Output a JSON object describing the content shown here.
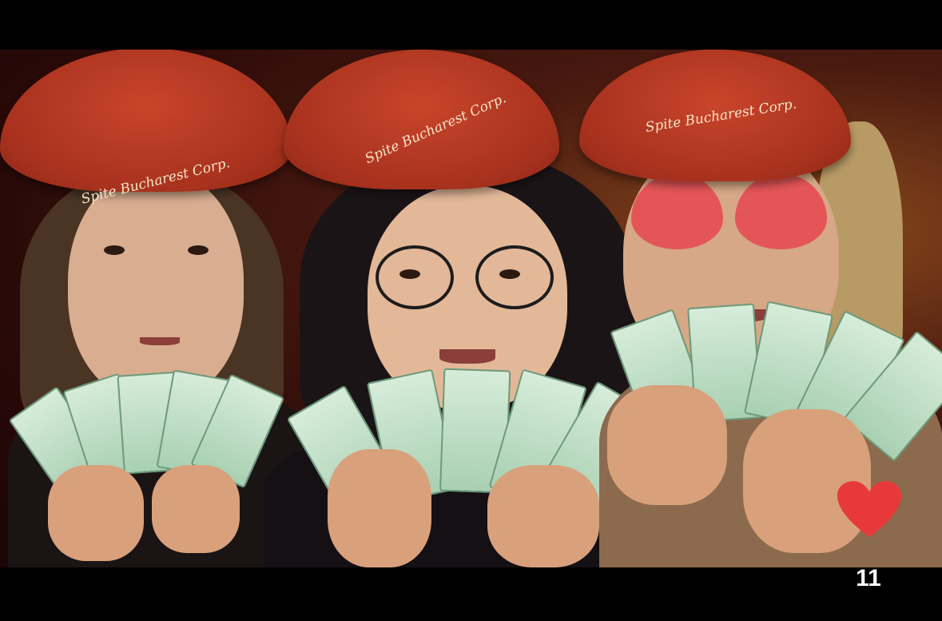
{
  "beret_text": {
    "left": "Spite Bucharest Corp.",
    "center": "Spite Bucharest Corp.",
    "right": "Spite Bucharest Corp."
  },
  "reaction": {
    "icon": "heart-icon",
    "color": "#e8393a",
    "count": "11"
  },
  "colors": {
    "beret": "#b0361f",
    "beret_text": "#f3e6c9",
    "background": "#3a1210"
  }
}
